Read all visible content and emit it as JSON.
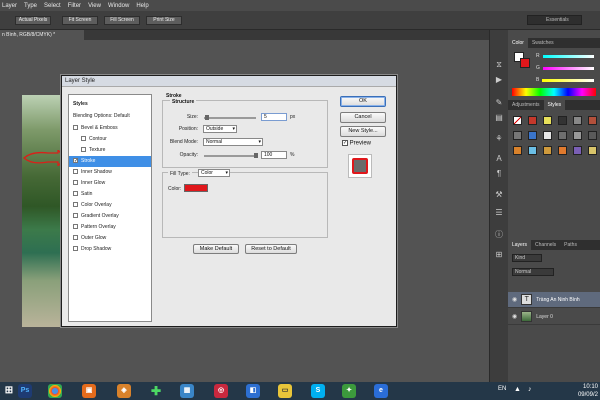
{
  "menu": [
    "Layer",
    "Type",
    "Select",
    "Filter",
    "View",
    "Window",
    "Help"
  ],
  "options_bar": {
    "buttons": [
      "Actual Pixels",
      "Fit Screen",
      "Fill Screen",
      "Print Size"
    ],
    "workspace": "Essentials"
  },
  "doc_tab": "n Bình, RGB/8/CMYK) *",
  "dialog": {
    "title": "Layer Style",
    "styles_header": "Styles",
    "blending_options": "Blending Options: Default",
    "styles": [
      {
        "label": "Bevel & Emboss",
        "checked": false
      },
      {
        "label": "Contour",
        "checked": false
      },
      {
        "label": "Texture",
        "checked": false
      },
      {
        "label": "Stroke",
        "checked": true
      },
      {
        "label": "Inner Shadow",
        "checked": false
      },
      {
        "label": "Inner Glow",
        "checked": false
      },
      {
        "label": "Satin",
        "checked": false
      },
      {
        "label": "Color Overlay",
        "checked": false
      },
      {
        "label": "Gradient Overlay",
        "checked": false
      },
      {
        "label": "Pattern Overlay",
        "checked": false
      },
      {
        "label": "Outer Glow",
        "checked": false
      },
      {
        "label": "Drop Shadow",
        "checked": false
      }
    ],
    "stroke_heading": "Stroke",
    "structure_heading": "Structure",
    "size_label": "Size:",
    "size_value": "5",
    "size_unit": "px",
    "position_label": "Position:",
    "position_value": "Outside",
    "blend_label": "Blend Mode:",
    "blend_value": "Normal",
    "opacity_label": "Opacity:",
    "opacity_value": "100",
    "opacity_unit": "%",
    "fill_type_label": "Fill Type:",
    "fill_type_value": "Color",
    "color_label": "Color:",
    "stroke_color": "#e0171b",
    "make_default": "Make Default",
    "reset_default": "Reset to Default",
    "ok": "OK",
    "cancel": "Cancel",
    "new_style": "New Style...",
    "preview": "Preview"
  },
  "panels": {
    "color_tabs": [
      "Color",
      "Swatches"
    ],
    "channel_letters": [
      "R",
      "G",
      "B"
    ],
    "adj_tabs": [
      "Adjustments",
      "Styles"
    ],
    "layer_tabs": [
      "Layers",
      "Channels",
      "Paths"
    ],
    "kind": "Kind",
    "blend": "Normal",
    "layers": [
      {
        "name": "Tràng An Ninh Bình",
        "type": "text"
      },
      {
        "name": "Layer 0",
        "type": "image"
      }
    ]
  },
  "taskbar": {
    "lang": "EN",
    "time": "10:10",
    "date": "09/09/2"
  }
}
